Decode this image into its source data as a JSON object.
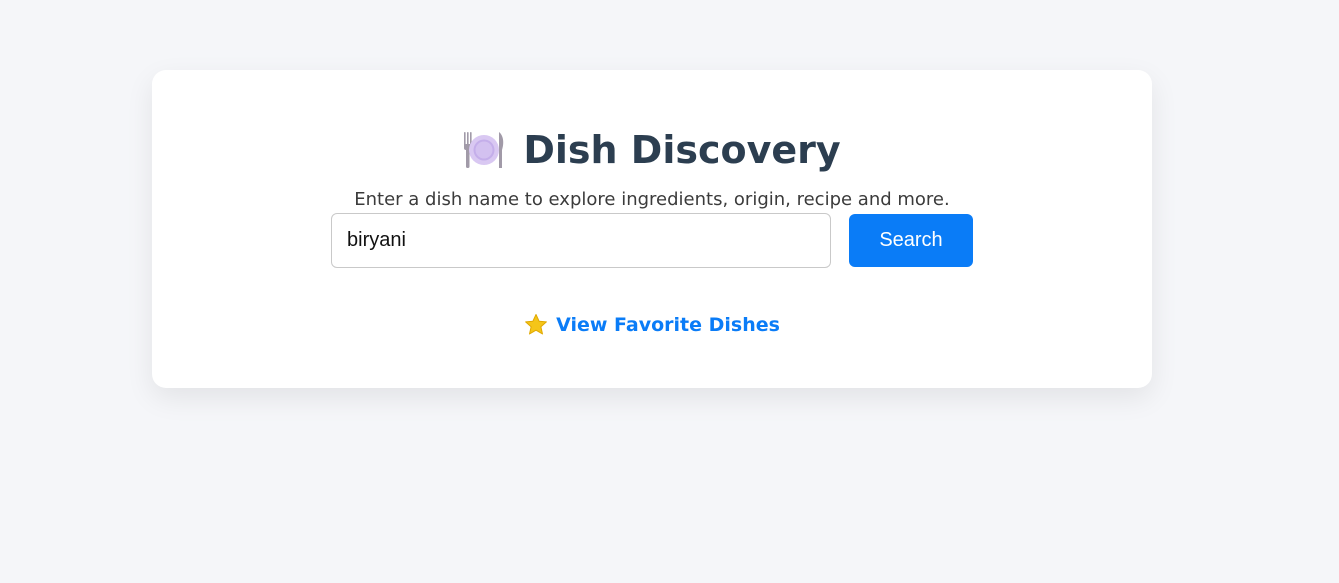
{
  "app": {
    "title": "Dish Discovery",
    "subtitle": "Enter a dish name to explore ingredients, origin, recipe and more.",
    "title_icon": "plate-with-cutlery-icon"
  },
  "search": {
    "value": "biryani",
    "placeholder": "",
    "button_label": "Search"
  },
  "favorites": {
    "label": "View Favorite Dishes",
    "icon": "star-icon"
  },
  "colors": {
    "background": "#f5f6f9",
    "card": "#ffffff",
    "title": "#2c3e50",
    "accent": "#0a7cf7",
    "star": "#f5c518"
  }
}
